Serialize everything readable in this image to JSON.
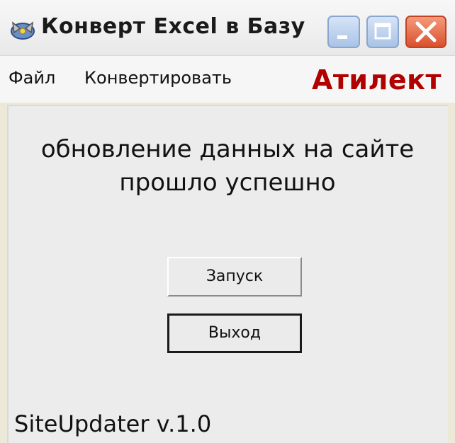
{
  "window": {
    "title": "Конверт Excel в Базу"
  },
  "menu": {
    "items": [
      "Файл",
      "Конвертировать"
    ]
  },
  "brand": {
    "name": "Атилект",
    "color": "#b10000"
  },
  "main": {
    "message_line1": "обновление данных на сайте",
    "message_line2": "прошло успешно",
    "start_button_label": "Запуск",
    "exit_button_label": "Выход",
    "version": "SiteUpdater v.1.0"
  },
  "icons": {
    "app": "app-logo-icon",
    "minimize": "minimize-icon",
    "maximize": "maximize-icon",
    "close": "close-icon"
  }
}
